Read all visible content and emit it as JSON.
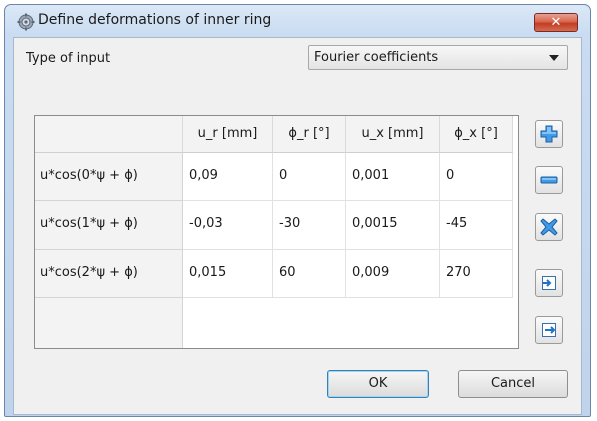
{
  "window": {
    "title": "Define deformations of inner ring",
    "close_label": "✕"
  },
  "input_type": {
    "label": "Type of input",
    "selected": "Fourier coefficients"
  },
  "table": {
    "columns": [
      "u_r [mm]",
      "ϕ_r [°]",
      "u_x [mm]",
      "ϕ_x [°]"
    ],
    "rows": [
      {
        "label": "u*cos(0*ψ + ϕ)",
        "values": [
          "0,09",
          "0",
          "0,001",
          "0"
        ]
      },
      {
        "label": "u*cos(1*ψ + ϕ)",
        "values": [
          "-0,03",
          "-30",
          "0,0015",
          "-45"
        ]
      },
      {
        "label": "u*cos(2*ψ + ϕ)",
        "values": [
          "0,015",
          "60",
          "0,009",
          "270"
        ]
      }
    ]
  },
  "side_buttons": [
    "add-row-icon",
    "remove-row-icon",
    "delete-all-icon",
    "import-icon",
    "export-icon"
  ],
  "buttons": {
    "ok": "OK",
    "cancel": "Cancel"
  }
}
